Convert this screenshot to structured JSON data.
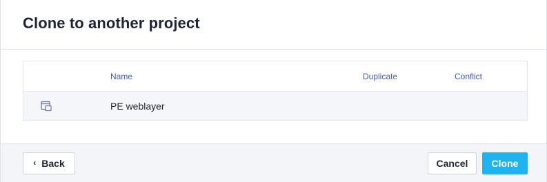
{
  "dialog": {
    "title": "Clone to another project"
  },
  "table": {
    "columns": {
      "name": "Name",
      "duplicate": "Duplicate",
      "conflict": "Conflict"
    },
    "rows": [
      {
        "icon": "project-window-icon",
        "name": "PE weblayer",
        "duplicate": "",
        "conflict": ""
      }
    ]
  },
  "footer": {
    "back_chevron": "‹",
    "back_label": "Back",
    "cancel_label": "Cancel",
    "clone_label": "Clone"
  },
  "colors": {
    "primary": "#1fb4ef",
    "header_text": "#4a5bb0",
    "title_text": "#1f2432",
    "row_bg": "#f5f6f9",
    "footer_bg": "#f4f5f9"
  }
}
